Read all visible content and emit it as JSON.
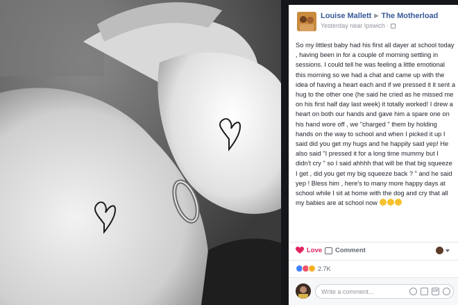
{
  "post": {
    "author": "Louise Mallett",
    "group": "The Motherload",
    "meta": "Yesterday near Ipswich ·",
    "body": "So my littlest baby had his first all dayer at school today , having been in for a couple of morning settling in sessions. I could tell he was feeling a little emotional this morning so we had a chat and came up with the idea of having a heart each and if we pressed it it sent a hug to the other one (he said he cried as he missed me on his first half day last week) it totally worked! I drew a heart on both our hands and gave him a spare one on his hand wore off , we \"charged \" them by holding hands on the way to school and when I picked it up I said did you get my hugs and he happily said yep! He also said \"I pressed it for a long time mummy but I didn't cry \" so I said ahhhh that will be that big squeeze I get , did you get my big squeeze back ? \" and he said yep ! Bless him , here's to many more happy days at school while I sit at home with the dog and cry that all my babies are at school now"
  },
  "actions": {
    "love_label": "Love",
    "comment_label": "Comment"
  },
  "reactions": {
    "count": "2.7K"
  },
  "comment_box": {
    "placeholder": "Write a comment..."
  },
  "icons": {
    "share_arrow": "triangle-right-icon",
    "privacy": "globe-icon",
    "love": "heart-icon",
    "comment": "speech-bubble-icon",
    "emoji_input": "smiley-icon",
    "camera": "camera-icon",
    "gif": "gif-icon",
    "sticker": "sticker-icon"
  },
  "colors": {
    "link": "#365899",
    "love": "#e0245e",
    "like": "#4080ff",
    "wow": "#f7b125",
    "backdrop": "#14161a"
  }
}
